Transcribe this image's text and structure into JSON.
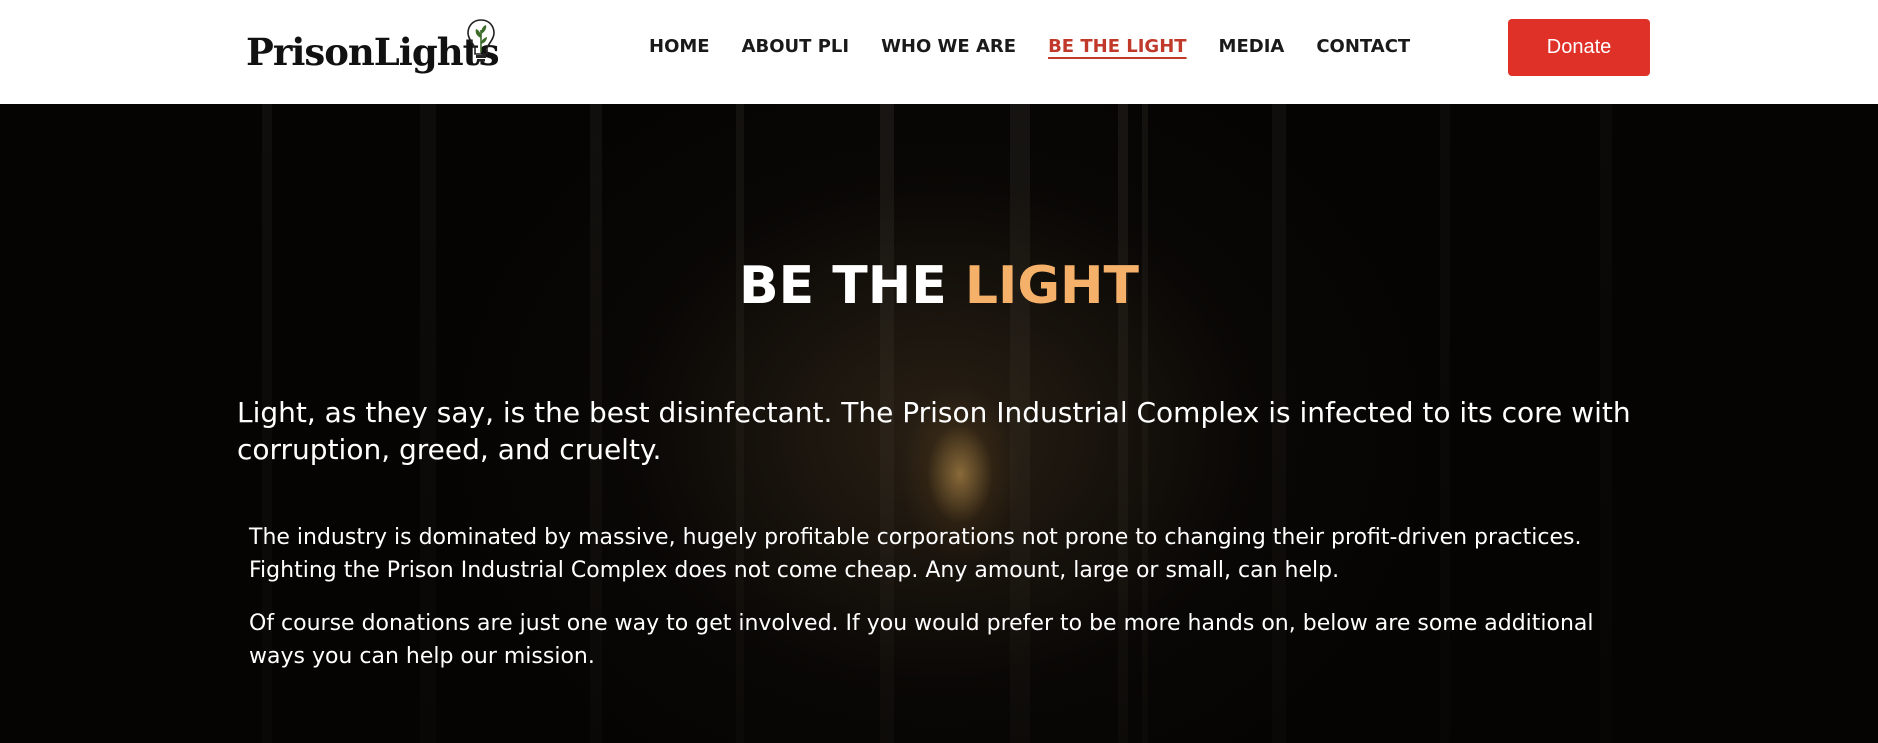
{
  "brand": {
    "logo_text": "PrisonLights",
    "logo_icon": "lightbulb-sprout-icon"
  },
  "nav": {
    "items": [
      {
        "label": "HOME",
        "active": false
      },
      {
        "label": "ABOUT PLI",
        "active": false
      },
      {
        "label": "WHO WE ARE",
        "active": false
      },
      {
        "label": "BE THE LIGHT",
        "active": true
      },
      {
        "label": "MEDIA",
        "active": false
      },
      {
        "label": "CONTACT",
        "active": false
      }
    ],
    "donate_label": "Donate"
  },
  "hero": {
    "title_part1": "BE THE ",
    "title_part2": "LIGHT",
    "lead": "Light, as they say, is the best disinfectant. The Prison Industrial Complex is infected to its core with corruption, greed, and cruelty.",
    "paragraphs": [
      "The industry is dominated by massive, hugely profitable corporations not prone to changing their profit-driven practices. Fighting the Prison Industrial Complex does not come cheap. Any amount, large or small, can help.",
      "Of course donations are just one way to get involved. If you would prefer to be more hands on, below are some additional ways you can help our mission."
    ]
  },
  "colors": {
    "accent": "#f5b16a",
    "active_nav": "#c0392b",
    "donate_bg": "#e03128",
    "hero_bg": "#050403"
  }
}
